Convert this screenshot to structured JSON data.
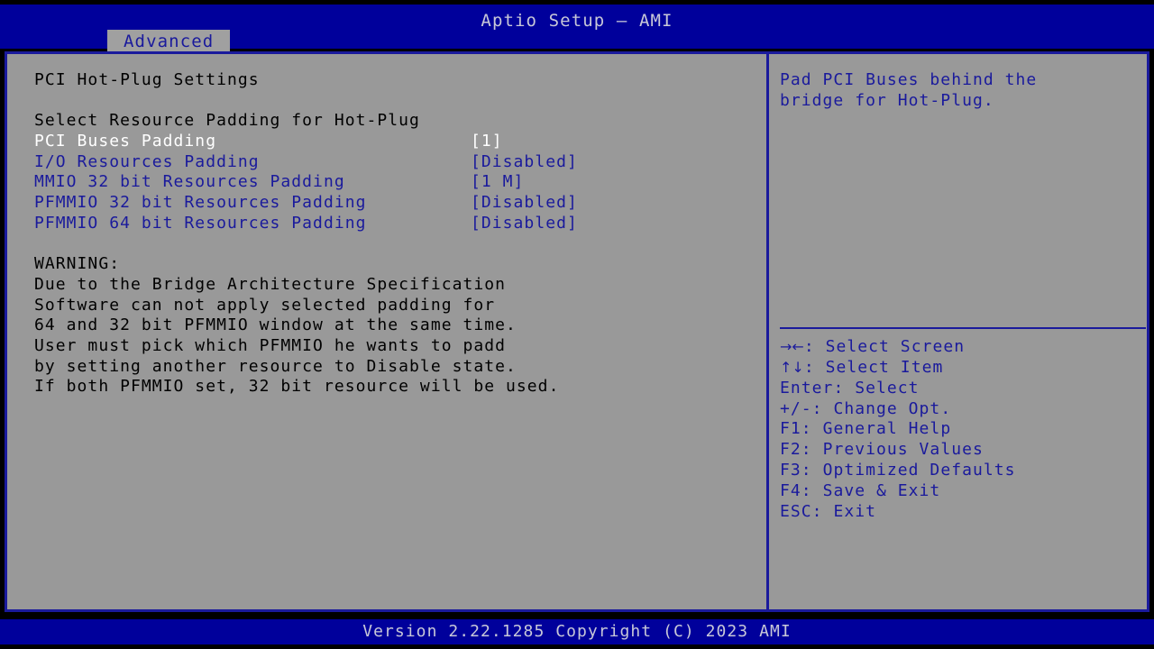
{
  "colors": {
    "header_blue": "#00009b",
    "frame_blue": "#1a1a9c",
    "panel_gray": "#999999",
    "selected_text": "#ffffff",
    "body_text": "#000000",
    "header_text": "#c8c8d8"
  },
  "header": {
    "title": "Aptio Setup – AMI",
    "tabs": [
      {
        "label": "Advanced",
        "active": true
      }
    ]
  },
  "menu": {
    "page_title": "PCI Hot-Plug Settings",
    "section_header": "Select Resource Padding for Hot-Plug",
    "options": [
      {
        "label": "PCI Buses Padding",
        "value": "[1]",
        "selected": true
      },
      {
        "label": "I/O Resources Padding",
        "value": "[Disabled]",
        "selected": false
      },
      {
        "label": "MMIO 32 bit Resources Padding",
        "value": "[1 M]",
        "selected": false
      },
      {
        "label": "PFMMIO 32 bit Resources Padding",
        "value": "[Disabled]",
        "selected": false
      },
      {
        "label": "PFMMIO 64 bit Resources Padding",
        "value": "[Disabled]",
        "selected": false
      }
    ],
    "warning": {
      "heading": "WARNING:",
      "lines": [
        "Due to the Bridge Architecture Specification",
        "Software can not apply selected padding for",
        "64 and 32 bit PFMMIO window at the same time.",
        "User must pick which PFMMIO he wants to padd",
        "by setting another resource to Disable state.",
        "If both PFMMIO set, 32 bit resource will be used."
      ]
    }
  },
  "help": {
    "description_lines": [
      "Pad PCI Buses behind the",
      "bridge for Hot-Plug."
    ],
    "legend": [
      {
        "keys": "→←",
        "sep": ": ",
        "action": "Select Screen",
        "icon": true
      },
      {
        "keys": "↑↓",
        "sep": ": ",
        "action": "Select Item",
        "icon": true
      },
      {
        "keys": "Enter",
        "sep": ": ",
        "action": "Select",
        "icon": false
      },
      {
        "keys": "+/-",
        "sep": ": ",
        "action": "Change Opt.",
        "icon": false
      },
      {
        "keys": "F1",
        "sep": ": ",
        "action": "General Help",
        "icon": false
      },
      {
        "keys": "F2",
        "sep": ": ",
        "action": "Previous Values",
        "icon": false
      },
      {
        "keys": "F3",
        "sep": ": ",
        "action": "Optimized Defaults",
        "icon": false
      },
      {
        "keys": "F4",
        "sep": ": ",
        "action": "Save & Exit",
        "icon": false
      },
      {
        "keys": "ESC",
        "sep": ": ",
        "action": "Exit",
        "icon": false
      }
    ]
  },
  "footer": {
    "version_text": "Version 2.22.1285 Copyright (C) 2023 AMI"
  }
}
